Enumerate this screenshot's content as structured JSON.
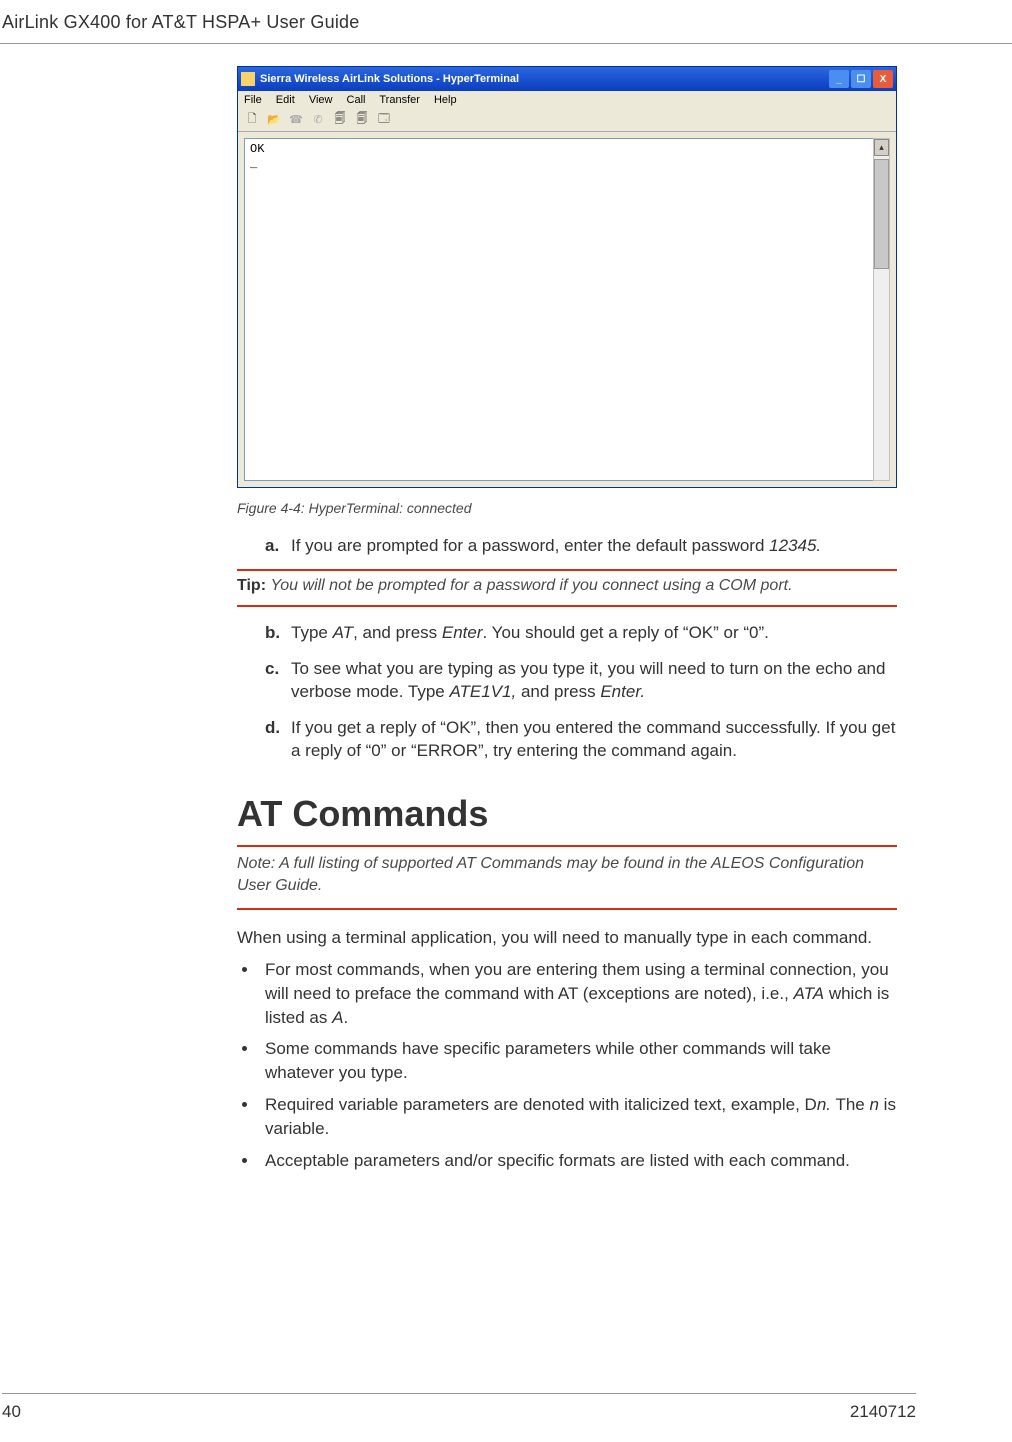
{
  "header_title": "AirLink GX400 for AT&T HSPA+ User Guide",
  "htwin": {
    "title": "Sierra Wireless AirLink Solutions - HyperTerminal",
    "menus": [
      "File",
      "Edit",
      "View",
      "Call",
      "Transfer",
      "Help"
    ],
    "terminal_text": "OK\n_"
  },
  "caption": "Figure 4-4:  HyperTerminal: connected",
  "step_a_label": "a.",
  "step_a_prefix": "If you are prompted for a password, enter the default password ",
  "step_a_em": "12345.",
  "tip_label": "Tip:  ",
  "tip_text": "You will not be prompted for a password if you connect using a COM port.",
  "step_b_label": "b.",
  "step_b_p1": "Type ",
  "step_b_em1": "AT",
  "step_b_p2": ", and press ",
  "step_b_em2": "Enter",
  "step_b_p3": ". You should get a reply of “OK” or “0”.",
  "step_c_label": "c.",
  "step_c_p1": "To see what you are typing as you type it, you will need to turn on the echo and verbose mode. Type ",
  "step_c_em1": "ATE1V1,",
  "step_c_p2": " and press ",
  "step_c_em2": "Enter.",
  "step_d_label": "d.",
  "step_d_text": "If you get a reply of “OK”, then you entered the command successfully. If you get a reply of “0” or “ERROR”, try entering the command again.",
  "section_heading": "AT Commands",
  "note_label": "Note:  ",
  "note_text": "A full listing of supported AT Commands may be found in the ALEOS Configuration User Guide.",
  "body_text": "When using a terminal application, you will need to manually type in each command.",
  "b1_p1": "For most commands, when you are entering them using a terminal connection, you will need to preface the command with AT (exceptions are noted), i.e., ",
  "b1_em1": "ATA",
  "b1_p2": " which is listed as ",
  "b1_em2": "A",
  "b1_p3": ".",
  "b2_text": "Some commands have specific parameters while other commands will take whatever you type.",
  "b3_p1": "Required variable parameters are denoted with italicized text, example, D",
  "b3_em1": "n.",
  "b3_p2": " The ",
  "b3_em2": "n",
  "b3_p3": " is variable.",
  "b4_text": "Acceptable parameters and/or specific formats are listed with each command.",
  "footer_page": "40",
  "footer_docid": "2140712"
}
